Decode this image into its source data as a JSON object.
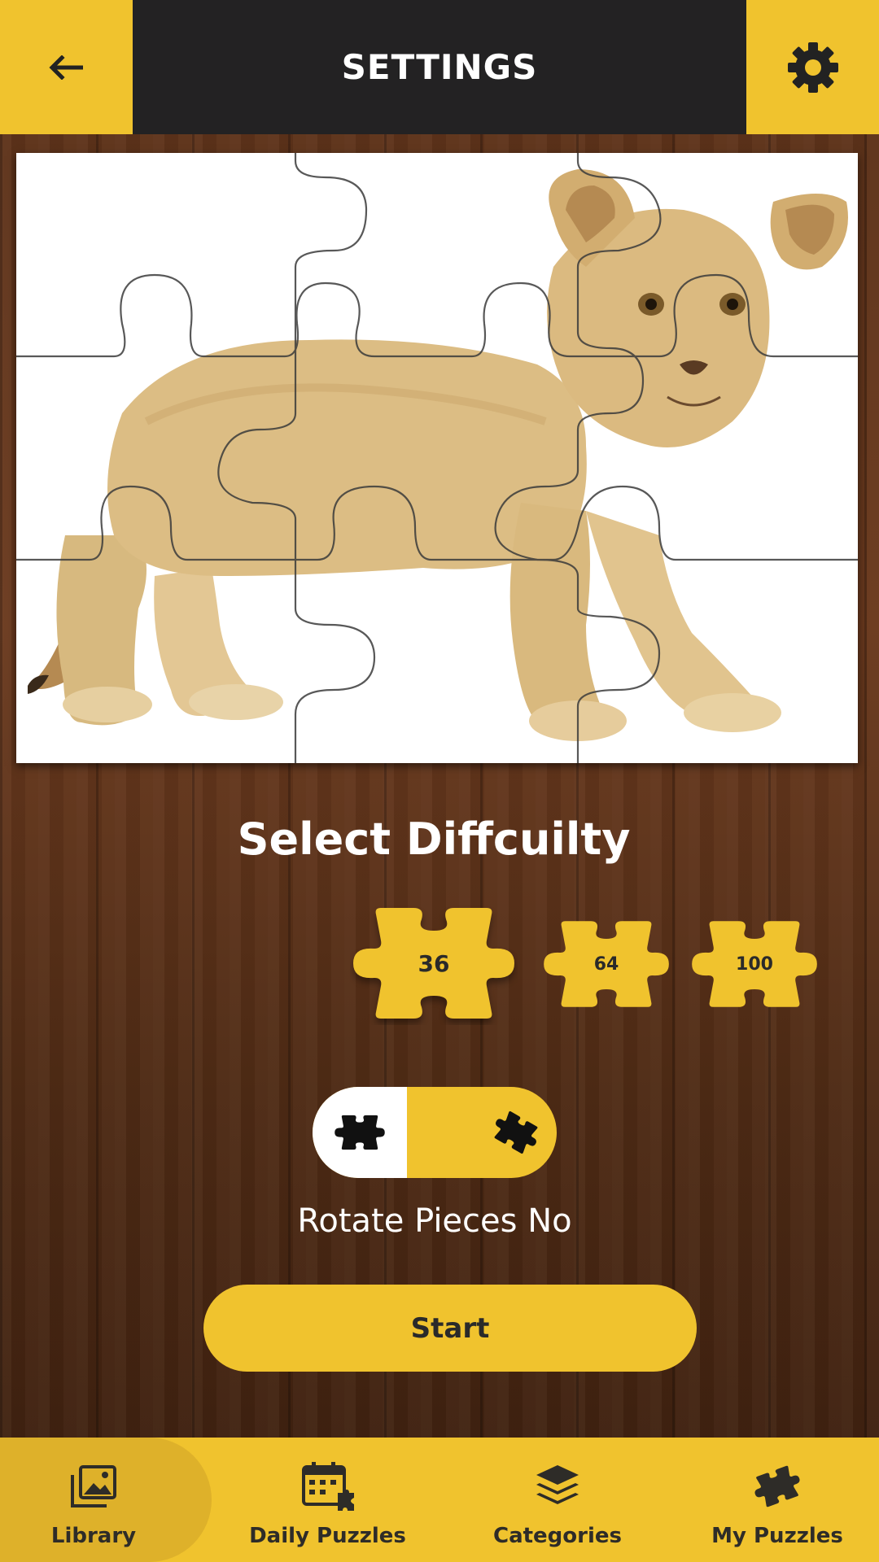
{
  "header": {
    "title": "SETTINGS",
    "back_icon": "arrow-left-icon",
    "settings_icon": "gear-icon"
  },
  "preview": {
    "subject": "lion-cub-photo",
    "grid_columns": 3,
    "grid_rows": 3
  },
  "difficulty": {
    "heading": "Select Diffcuilty",
    "options": [
      {
        "label": "36",
        "selected": true
      },
      {
        "label": "64",
        "selected": false
      },
      {
        "label": "100",
        "selected": false
      }
    ]
  },
  "rotate": {
    "label": "Rotate Pieces No",
    "enabled": false,
    "left_icon": "puzzle-piece-icon",
    "right_icon": "rotated-puzzle-piece-icon"
  },
  "start": {
    "label": "Start"
  },
  "bottom_nav": {
    "items": [
      {
        "label": "Library",
        "icon": "gallery-icon",
        "active": true
      },
      {
        "label": "Daily Puzzles",
        "icon": "calendar-puzzle-icon",
        "active": false
      },
      {
        "label": "Categories",
        "icon": "layers-icon",
        "active": false
      },
      {
        "label": "My Puzzles",
        "icon": "puzzle-piece-icon",
        "active": false
      }
    ]
  },
  "colors": {
    "accent": "#f0c32e",
    "header_dark": "#232223",
    "nav_active": "#deb12a",
    "text_dark": "#2a2a2a"
  }
}
